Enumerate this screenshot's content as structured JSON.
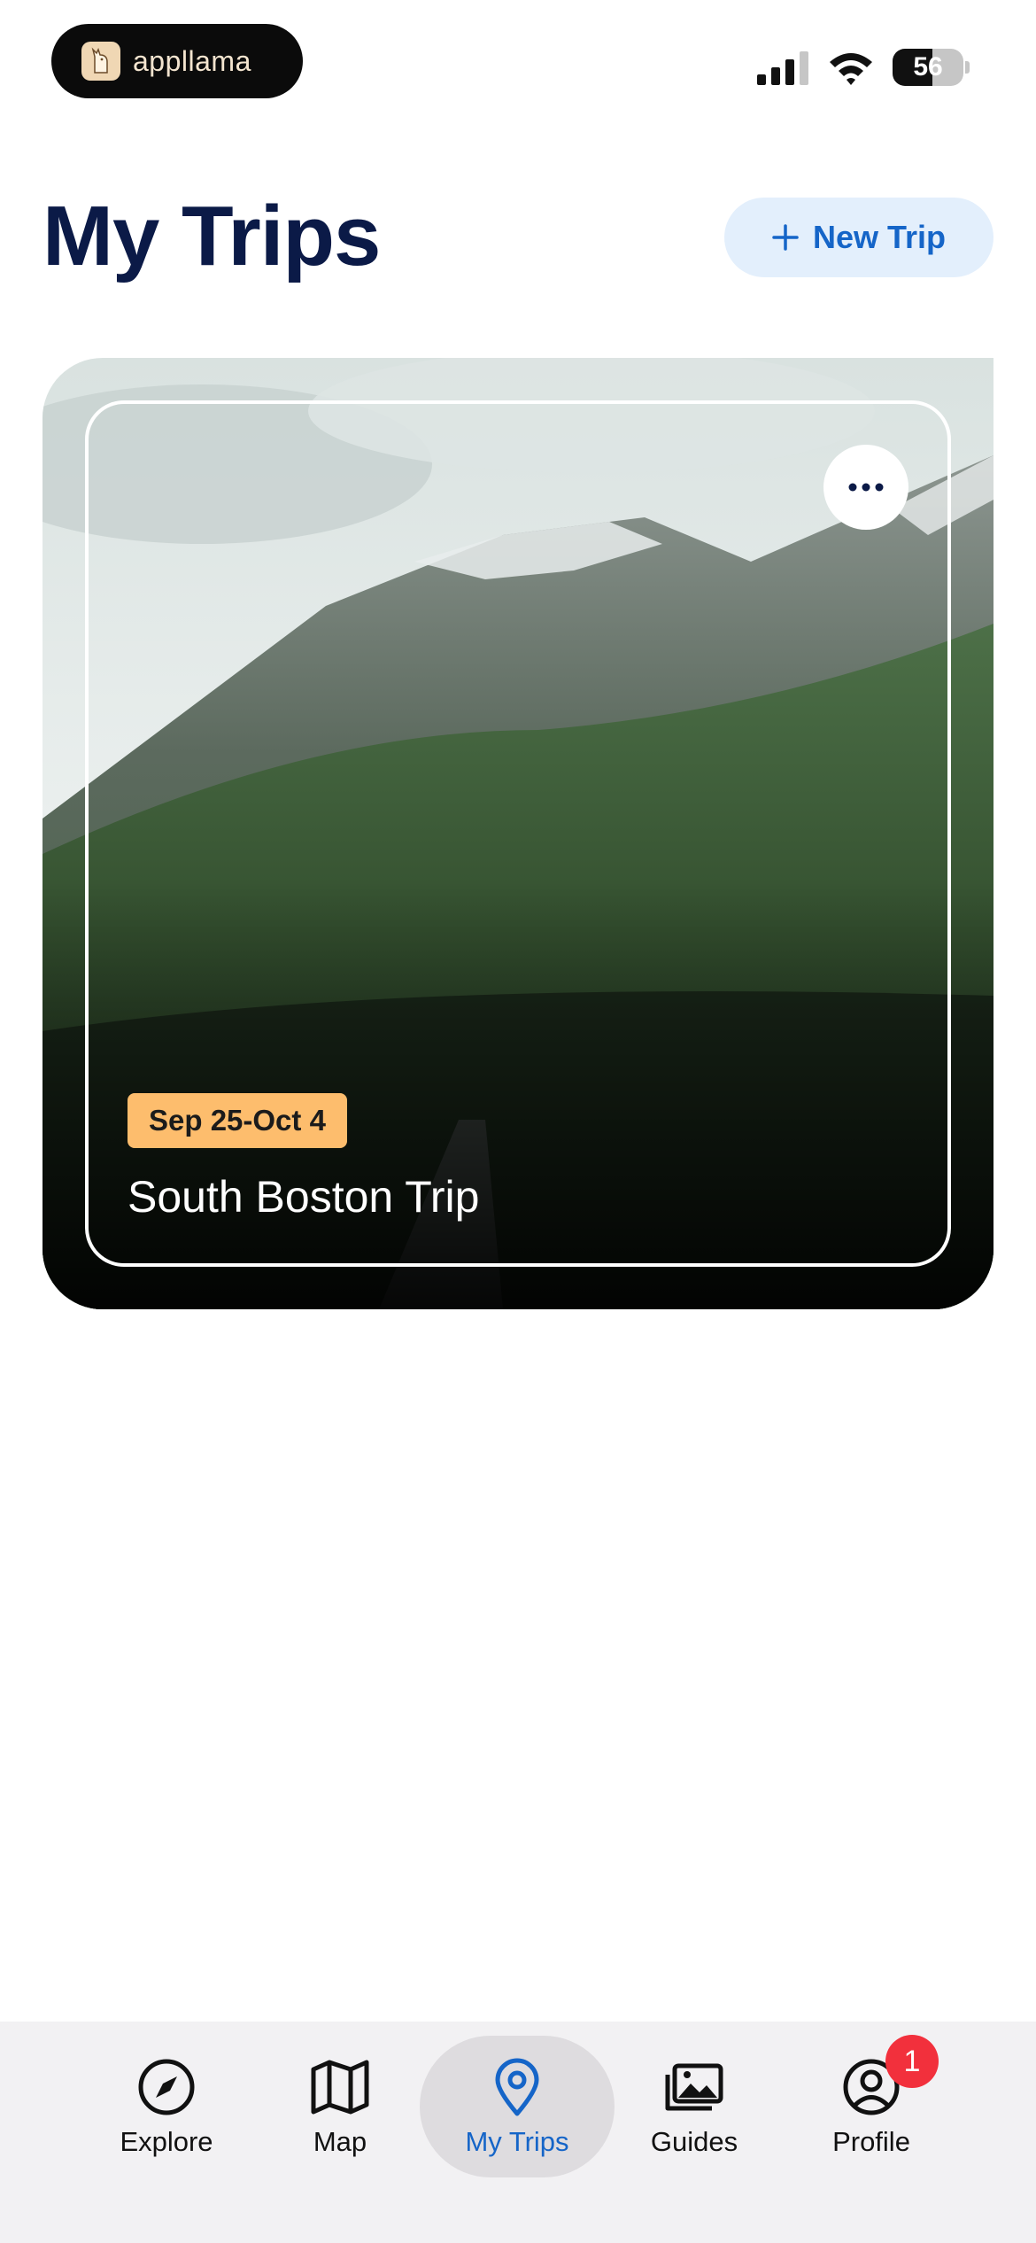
{
  "status_bar": {
    "app_name": "appllama",
    "battery_level": "56",
    "signal_icon": "cellular-signal-icon",
    "wifi_icon": "wifi-icon"
  },
  "header": {
    "title": "My Trips",
    "new_trip_label": "New Trip"
  },
  "trips": [
    {
      "dates": "Sep 25-Oct 4",
      "title": "South Boston Trip",
      "more_icon": "ellipsis-icon"
    }
  ],
  "tab_bar": {
    "tabs": [
      {
        "label": "Explore",
        "icon": "compass-icon"
      },
      {
        "label": "Map",
        "icon": "map-icon"
      },
      {
        "label": "My Trips",
        "icon": "location-pin-icon",
        "active": true
      },
      {
        "label": "Guides",
        "icon": "photos-icon"
      },
      {
        "label": "Profile",
        "icon": "user-circle-icon",
        "badge": "1"
      }
    ]
  },
  "colors": {
    "accent": "#1565c8",
    "title": "#0b1a47",
    "date_badge": "#fdbd6d",
    "notification": "#f2303c"
  }
}
